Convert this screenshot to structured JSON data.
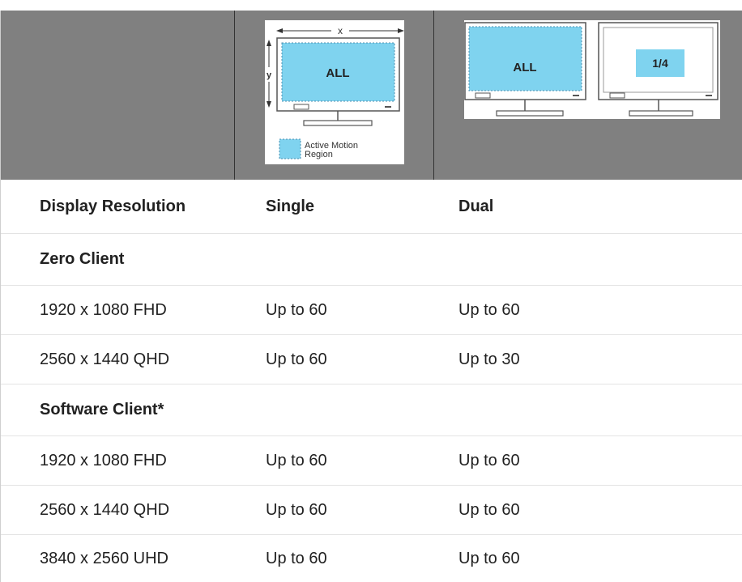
{
  "figures": {
    "single": {
      "x_label": "x",
      "y_label": "y",
      "screen_text": "ALL",
      "legend_text_line1": "Active Motion",
      "legend_text_line2": "Region"
    },
    "dual": {
      "left_screen_text": "ALL",
      "right_screen_text": "1/4"
    }
  },
  "table": {
    "headers": [
      "Display Resolution",
      "Single",
      "Dual"
    ],
    "sections": [
      {
        "title": "Zero Client",
        "rows": [
          [
            "1920 x 1080 FHD",
            "Up to 60",
            "Up to 60"
          ],
          [
            "2560 x 1440 QHD",
            "Up to 60",
            "Up to 30"
          ]
        ]
      },
      {
        "title": "Software Client*",
        "rows": [
          [
            "1920 x 1080 FHD",
            "Up to 60",
            "Up to 60"
          ],
          [
            "2560 x 1440 QHD",
            "Up to 60",
            "Up to 60"
          ],
          [
            "3840 x 2560 UHD",
            "Up to 60",
            "Up to 60"
          ]
        ]
      }
    ]
  },
  "colors": {
    "header_band": "#808080",
    "active_region": "#7fd3ef",
    "row_divider": "#e3e3e3"
  }
}
